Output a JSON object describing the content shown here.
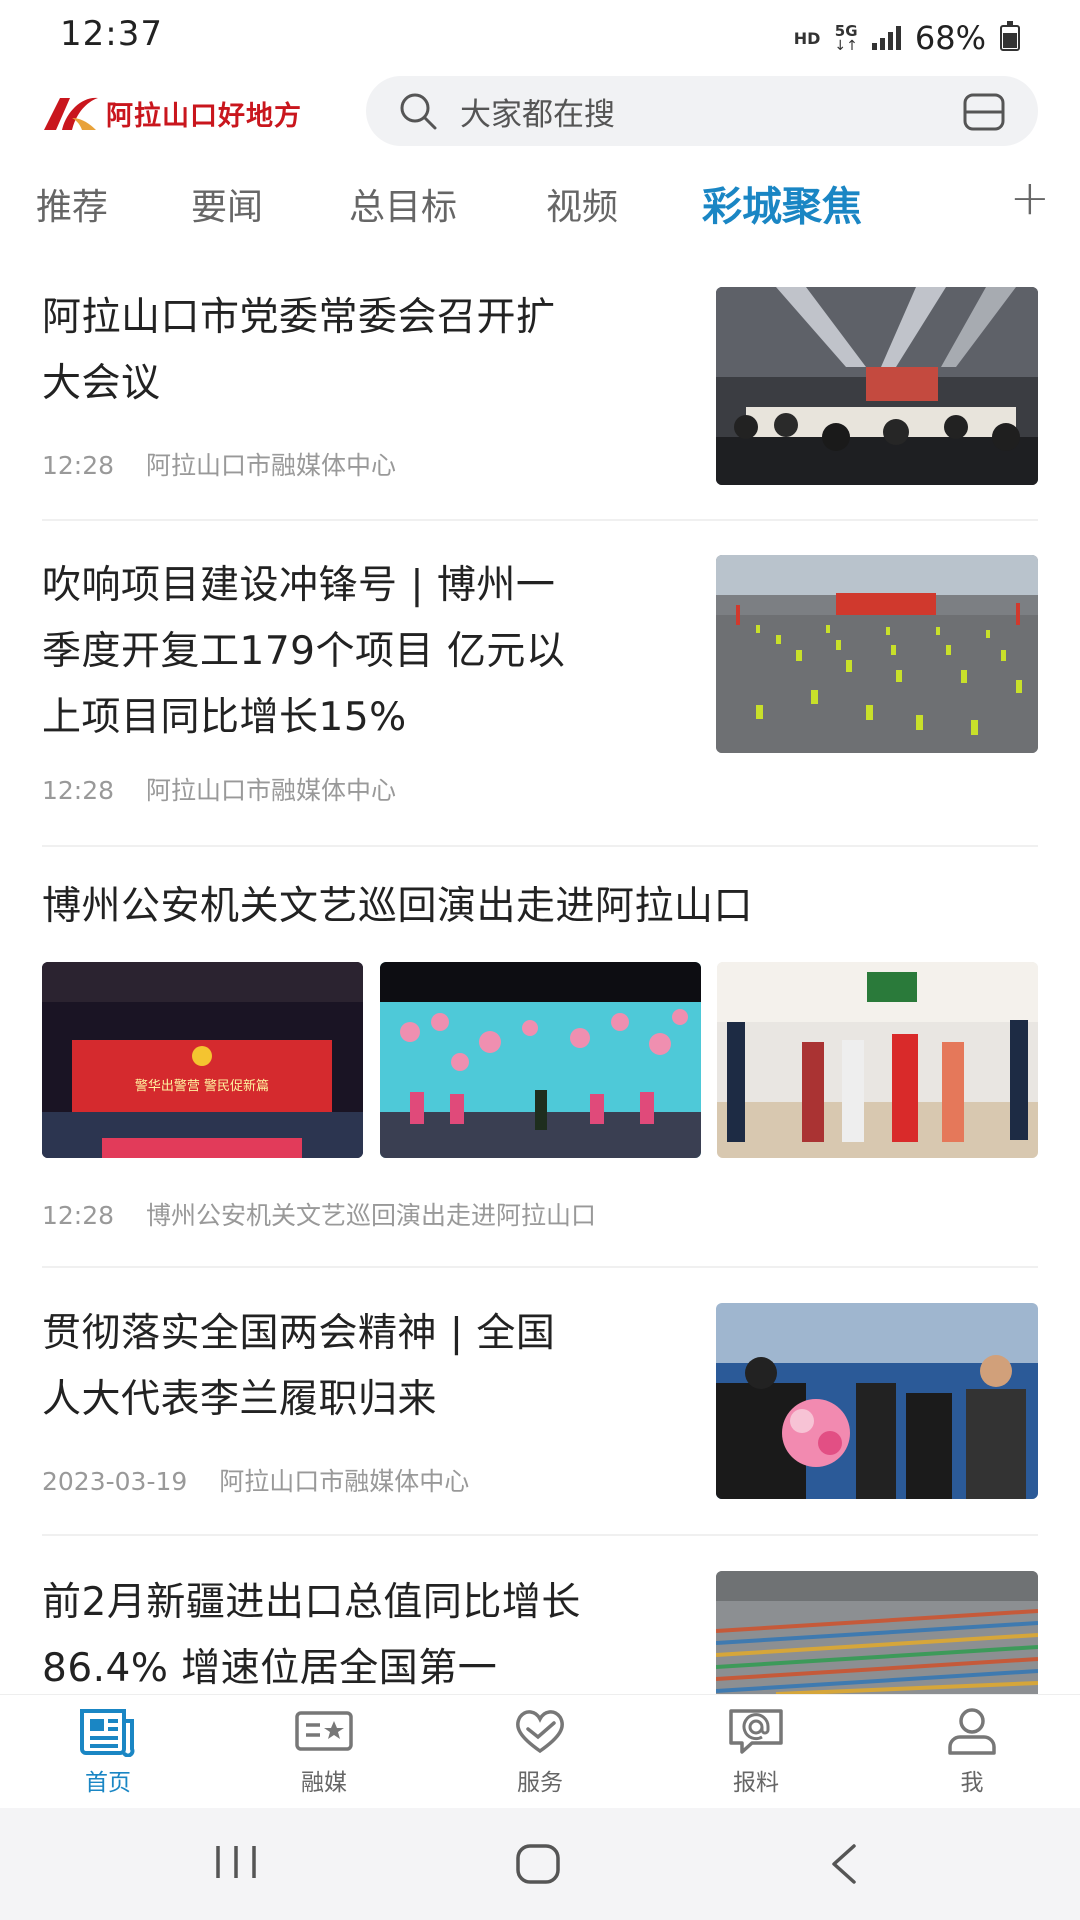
{
  "status_bar": {
    "time": "12:37",
    "hd": "HD",
    "network": "5G",
    "network_arrows": "↓↑",
    "battery": "68%",
    "battery_level": 0.68
  },
  "header": {
    "logo_text": "阿拉山口好地方",
    "search_placeholder": "大家都在搜"
  },
  "tabs": [
    {
      "label": "推荐",
      "active": false
    },
    {
      "label": "要闻",
      "active": false
    },
    {
      "label": "总目标",
      "active": false
    },
    {
      "label": "视频",
      "active": false
    },
    {
      "label": "彩城聚焦",
      "active": true
    }
  ],
  "tab_add": "+",
  "feed": [
    {
      "title_lines": [
        "阿拉山口市党委常委会召开扩",
        "大会议"
      ],
      "time": "12:28",
      "source": "阿拉山口市融媒体中心"
    },
    {
      "title_lines": [
        "吹响项目建设冲锋号 | 博州一",
        "季度开复工179个项目 亿元以",
        "上项目同比增长15%"
      ],
      "time": "12:28",
      "source": "阿拉山口市融媒体中心"
    },
    {
      "title_lines": [
        "博州公安机关文艺巡回演出走进阿拉山口"
      ],
      "time": "12:28",
      "source": "博州公安机关文艺巡回演出走进阿拉山口",
      "banner_text": "警华出警营  警民促新篇"
    },
    {
      "title_lines": [
        "贯彻落实全国两会精神 | 全国",
        "人大代表李兰履职归来"
      ],
      "time": "2023-03-19",
      "source": "阿拉山口市融媒体中心"
    },
    {
      "title_lines": [
        "前2月新疆进出口总值同比增长",
        "86.4% 增速位居全国第一"
      ]
    }
  ],
  "bottom_nav": [
    {
      "label": "首页",
      "active": true
    },
    {
      "label": "融媒",
      "active": false
    },
    {
      "label": "服务",
      "active": false
    },
    {
      "label": "报料",
      "active": false
    },
    {
      "label": "我",
      "active": false
    }
  ],
  "colors": {
    "accent": "#1a86c4",
    "brand_red": "#c9161d",
    "meta_gray": "#999999"
  }
}
